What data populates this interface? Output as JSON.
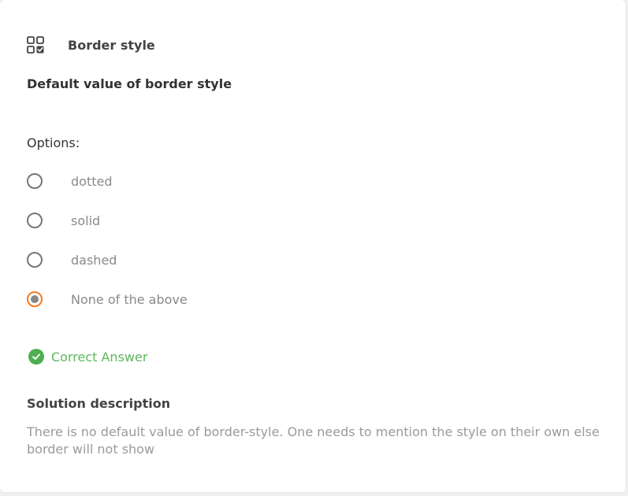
{
  "question_card": {
    "category_icon": "grid-check-icon",
    "category_title": "Border style",
    "question": "Default value of border style",
    "options_label": "Options:",
    "options": [
      {
        "label": "dotted",
        "selected": false
      },
      {
        "label": "solid",
        "selected": false
      },
      {
        "label": "dashed",
        "selected": false
      },
      {
        "label": "None of the above",
        "selected": true
      }
    ],
    "result_icon": "check-circle-icon",
    "result_text": "Correct Answer",
    "solution_title": "Solution description",
    "solution_text": "There is no default value of border-style. One needs to mention the style on their own else border will not show"
  },
  "colors": {
    "selected_radio_border": "#f47b20",
    "correct_green": "#4caf50",
    "correct_text": "#5cb85c"
  }
}
